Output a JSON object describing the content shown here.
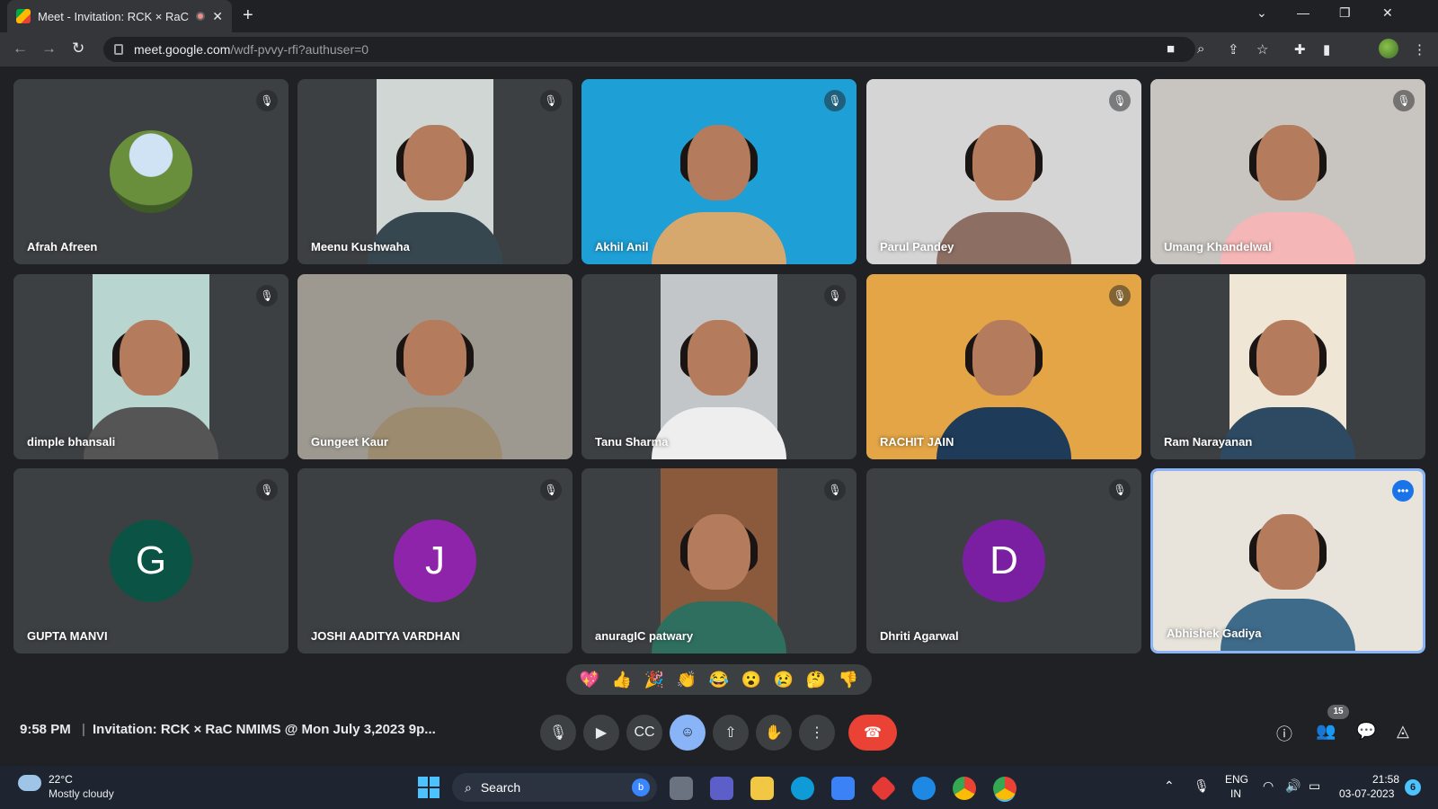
{
  "browser": {
    "tab_title": "Meet - Invitation: RCK × RaC",
    "close_glyph": "✕",
    "new_tab_glyph": "+",
    "url_host": "meet.google.com",
    "url_path": "/wdf-pvvy-rfi?authuser=0",
    "window_controls": [
      "⌄",
      "—",
      "❐",
      "✕"
    ]
  },
  "participants": [
    {
      "name": "Afrah Afreen",
      "muted": true,
      "kind": "avatar",
      "bg": "#3c4043"
    },
    {
      "name": "Meenu Kushwaha",
      "muted": true,
      "kind": "video",
      "bg": "#cfd6d4"
    },
    {
      "name": "Akhil Anil",
      "muted": true,
      "kind": "video",
      "bg": "#1e9fd6"
    },
    {
      "name": "Parul Pandey",
      "muted": true,
      "kind": "video",
      "bg": "#d5d5d5"
    },
    {
      "name": "Umang Khandelwal",
      "muted": true,
      "kind": "video",
      "bg": "#c8c5c0"
    },
    {
      "name": "dimple bhansali",
      "muted": true,
      "kind": "video",
      "bg": "#b8d6cf"
    },
    {
      "name": "Gungeet Kaur",
      "muted": false,
      "kind": "video",
      "bg": "#9d9991"
    },
    {
      "name": "Tanu Sharma",
      "muted": true,
      "kind": "video",
      "bg": "#c2c6c8"
    },
    {
      "name": "RACHIT JAIN",
      "muted": true,
      "kind": "video",
      "bg": "#e3a545"
    },
    {
      "name": "Ram Narayanan",
      "muted": false,
      "kind": "video",
      "bg": "#f0e6d6"
    },
    {
      "name": "GUPTA MANVI",
      "muted": true,
      "kind": "letter",
      "letter": "G",
      "color": "#0b5345"
    },
    {
      "name": "JOSHI AADITYA VARDHAN",
      "muted": true,
      "kind": "letter",
      "letter": "J",
      "color": "#8e24aa"
    },
    {
      "name": "anuragIC patwary",
      "muted": true,
      "kind": "video",
      "bg": "#8b5a3c"
    },
    {
      "name": "Dhriti Agarwal",
      "muted": true,
      "kind": "letter",
      "letter": "D",
      "color": "#7b1fa2"
    },
    {
      "name": "Abhishek Gadiya",
      "muted": false,
      "kind": "video",
      "bg": "#e8e4dc",
      "active": true
    }
  ],
  "reactions": [
    "💖",
    "👍",
    "🎉",
    "👏",
    "😂",
    "😮",
    "😢",
    "🤔",
    "👎"
  ],
  "bottom_bar": {
    "time": "9:58 PM",
    "separator": "|",
    "meeting_title": "Invitation: RCK × RaC NMIMS @ Mon July 3,2023 9p...",
    "people_count": "15"
  },
  "icons": {
    "mute": "🎙",
    "more": "•••"
  },
  "taskbar": {
    "temperature": "22°C",
    "weather": "Mostly cloudy",
    "search_label": "Search",
    "lang": "ENG",
    "region": "IN",
    "clock_time": "21:58",
    "clock_date": "03-07-2023",
    "notifications": "6"
  }
}
